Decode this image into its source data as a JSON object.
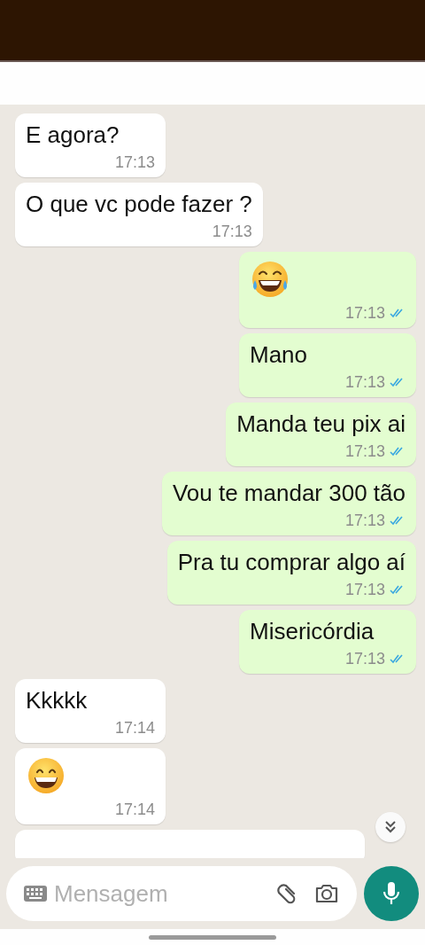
{
  "messages": [
    {
      "kind": "text",
      "outgoing": false,
      "text": "E agora?",
      "time": "17:13"
    },
    {
      "kind": "text",
      "outgoing": false,
      "text": "O que vc pode fazer ?",
      "time": "17:13"
    },
    {
      "kind": "emoji-laughing",
      "outgoing": true,
      "time": "17:13",
      "read": true
    },
    {
      "kind": "text",
      "outgoing": true,
      "text": "Mano",
      "time": "17:13",
      "read": true
    },
    {
      "kind": "text",
      "outgoing": true,
      "text": "Manda teu pix ai",
      "time": "17:13",
      "read": true
    },
    {
      "kind": "text",
      "outgoing": true,
      "text": "Vou te mandar 300 tão",
      "time": "17:13",
      "read": true
    },
    {
      "kind": "text",
      "outgoing": true,
      "text": "Pra tu comprar algo aí",
      "time": "17:13",
      "read": true
    },
    {
      "kind": "text",
      "outgoing": true,
      "text": "Misericórdia",
      "time": "17:13",
      "read": true
    },
    {
      "kind": "text",
      "outgoing": false,
      "text": "Kkkkk",
      "time": "17:14"
    },
    {
      "kind": "emoji-grin",
      "outgoing": false,
      "time": "17:14"
    }
  ],
  "composer": {
    "placeholder": "Mensagem"
  }
}
